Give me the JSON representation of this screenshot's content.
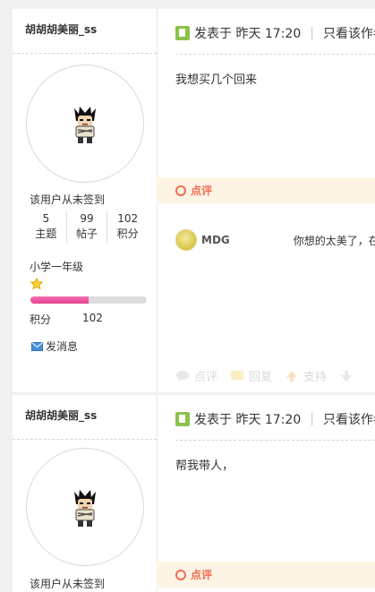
{
  "posts": [
    {
      "author": "胡胡胡美丽_ss",
      "signin_status": "该用户从未签到",
      "stats": [
        {
          "value": "5",
          "label": "主题"
        },
        {
          "value": "99",
          "label": "帖子"
        },
        {
          "value": "102",
          "label": "积分"
        }
      ],
      "level": "小学一年级",
      "level_progress": 0.5,
      "points_label": "积分",
      "points_value": "102",
      "message_label": "发消息",
      "meta_posted": "发表于 昨天 17:20",
      "meta_only_author": "只看该作者",
      "content": "我想买几个回来",
      "comment_label": "点评",
      "comment": {
        "user": "MDG",
        "text": "你想的太美了，在我"
      },
      "actions": {
        "review": "点评",
        "reply": "回复",
        "support": "支持"
      }
    },
    {
      "author": "胡胡胡美丽_ss",
      "signin_status": "该用户从未签到",
      "meta_posted": "发表于 昨天 17:20",
      "meta_only_author": "只看该作者",
      "content": "帮我带人，",
      "comment_label": "点评"
    }
  ],
  "colors": {
    "accent_orange": "#f26c4f",
    "comment_bar_bg": "#fdf4e6",
    "level_bar_pink": "#e4418f",
    "meta_icon_green": "#8bc34a"
  },
  "icons": {
    "avatar": "wolverine-cartoon-avatar",
    "level_star": "star-icon",
    "message": "envelope-icon",
    "meta": "post-document-icon"
  },
  "separator": "|"
}
